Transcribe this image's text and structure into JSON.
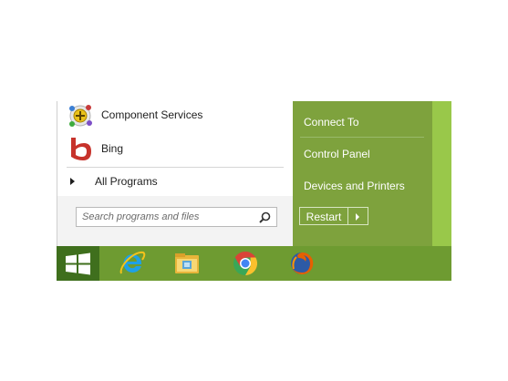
{
  "colors": {
    "right_pane": "#7ea23d",
    "taskbar": "#6e9b31",
    "start_button": "#3f6f1d",
    "accent": "#99c84a"
  },
  "left_pane": {
    "programs": [
      {
        "label": "Component Services",
        "icon": "component-services-icon"
      },
      {
        "label": "Bing",
        "icon": "bing-icon"
      }
    ],
    "all_programs_label": "All Programs",
    "search": {
      "placeholder": "Search programs and files",
      "value": "",
      "icon": "search-icon"
    }
  },
  "right_pane": {
    "items": [
      {
        "label": "Connect To"
      },
      {
        "label": "Control Panel"
      },
      {
        "label": "Devices and Printers"
      }
    ],
    "restart_label": "Restart"
  },
  "taskbar": {
    "start_icon": "windows-logo-icon",
    "pinned": [
      {
        "name": "internet-explorer-icon"
      },
      {
        "name": "file-explorer-icon"
      },
      {
        "name": "chrome-icon"
      },
      {
        "name": "firefox-icon"
      }
    ]
  }
}
